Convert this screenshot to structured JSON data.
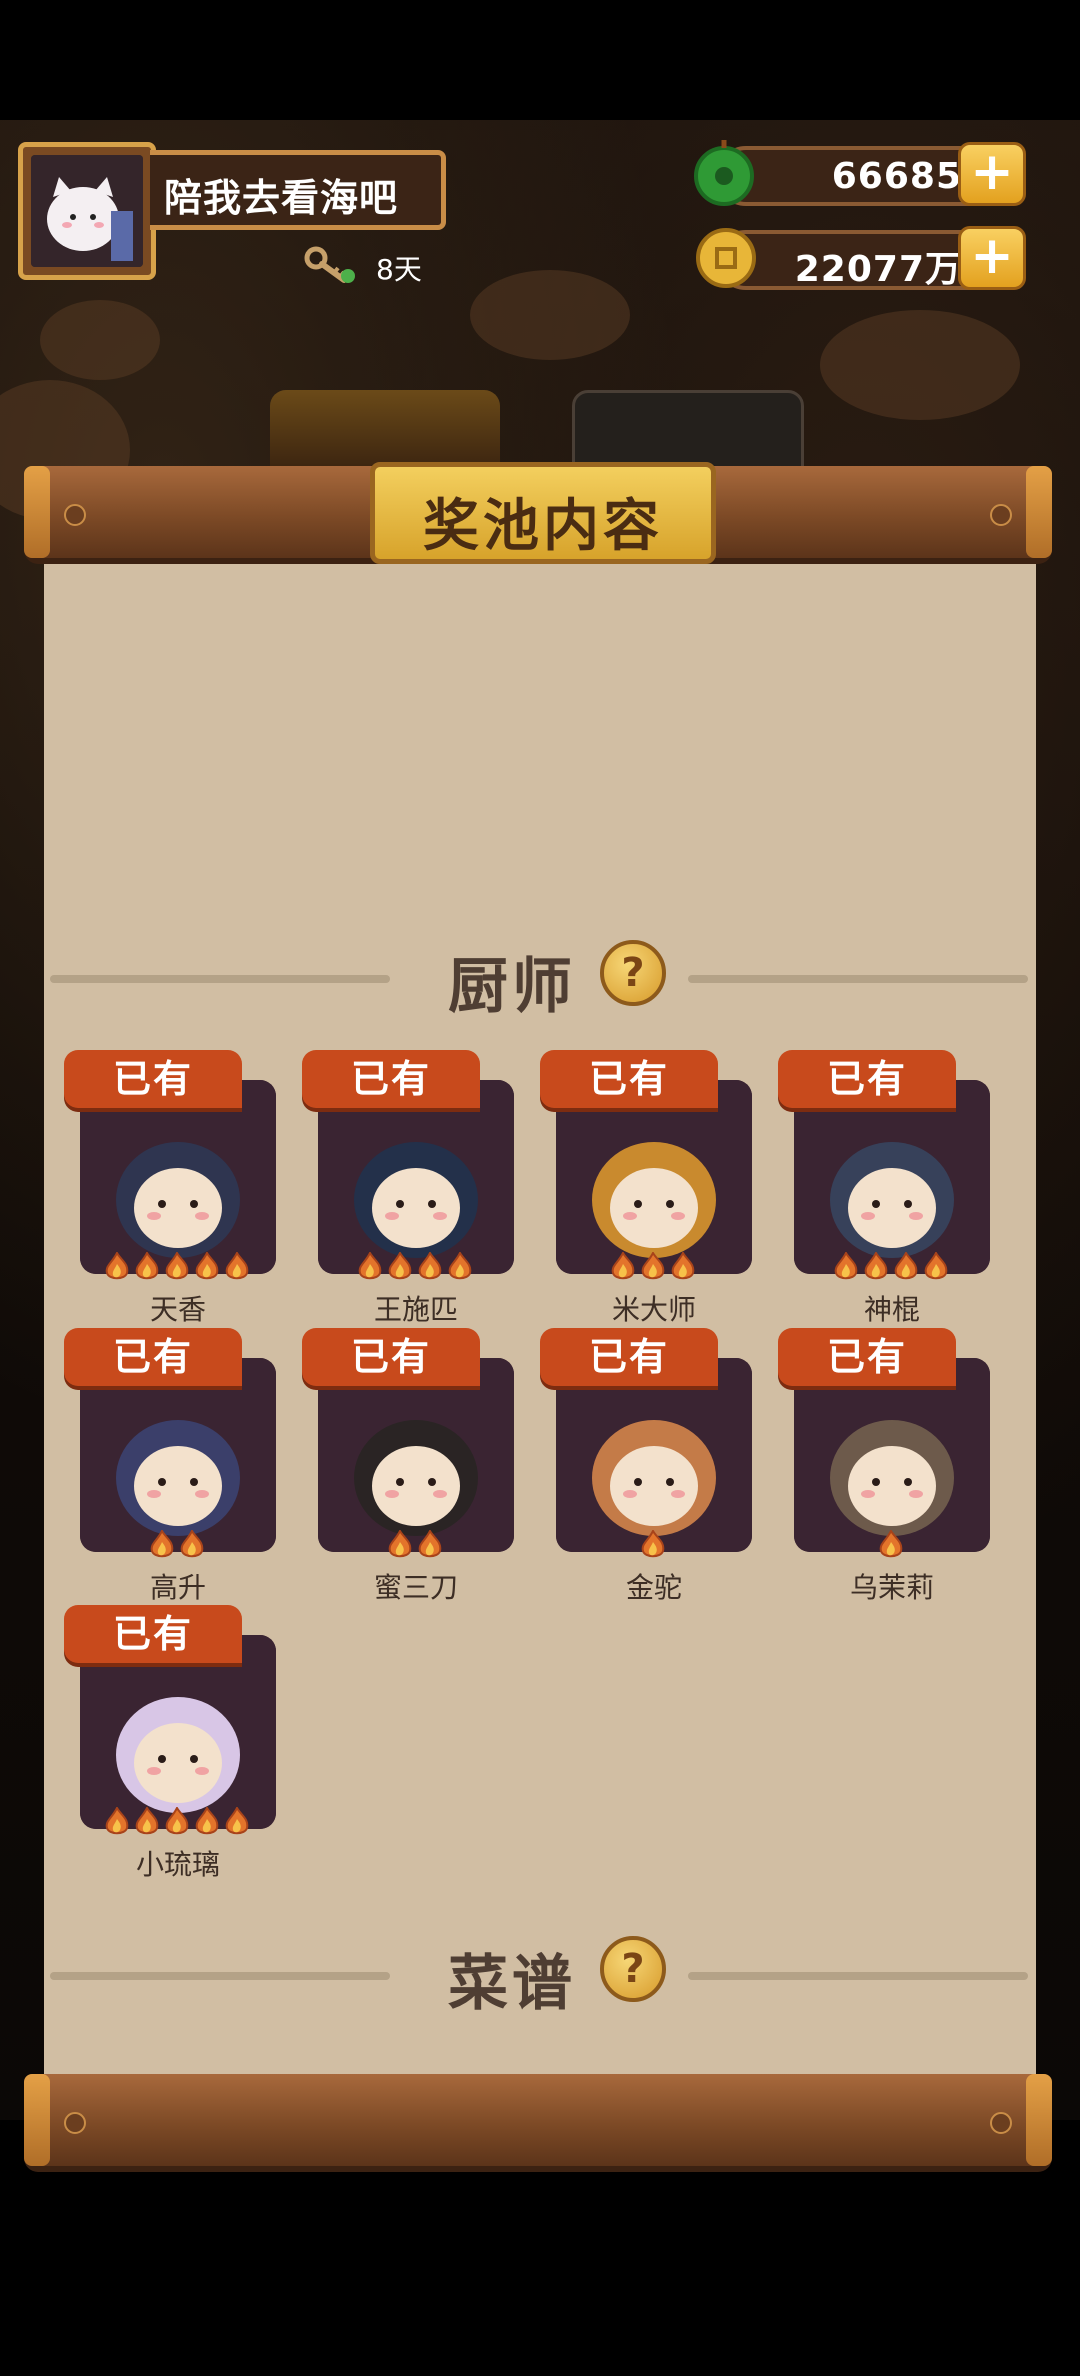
{
  "header": {
    "player_name": "陪我去看海吧",
    "days": "8天",
    "currencies": [
      {
        "name": "jade",
        "value": "66685",
        "icon": "jade-icon"
      },
      {
        "name": "coins",
        "value": "22077万",
        "icon": "coin-icon"
      }
    ],
    "plus_label": "+"
  },
  "panel": {
    "title": "奖池内容",
    "sections": [
      {
        "title": "厨师",
        "help_label": "?"
      },
      {
        "title": "菜谱",
        "help_label": "?"
      }
    ]
  },
  "chefs": [
    {
      "name": "天香",
      "tag": "已有",
      "stars": 5,
      "color": "#2f3550"
    },
    {
      "name": "王施匹",
      "tag": "已有",
      "stars": 4,
      "color": "#23304a"
    },
    {
      "name": "米大师",
      "tag": "已有",
      "stars": 3,
      "color": "#c98a2e"
    },
    {
      "name": "神棍",
      "tag": "已有",
      "stars": 4,
      "color": "#37415a"
    },
    {
      "name": "高升",
      "tag": "已有",
      "stars": 2,
      "color": "#3b3f6a"
    },
    {
      "name": "蜜三刀",
      "tag": "已有",
      "stars": 2,
      "color": "#2a2424"
    },
    {
      "name": "金驼",
      "tag": "已有",
      "stars": 1,
      "color": "#c47b48"
    },
    {
      "name": "乌茉莉",
      "tag": "已有",
      "stars": 1,
      "color": "#6d5a4b"
    },
    {
      "name": "小琉璃",
      "tag": "已有",
      "stars": 5,
      "color": "#d8c6e6"
    }
  ]
}
